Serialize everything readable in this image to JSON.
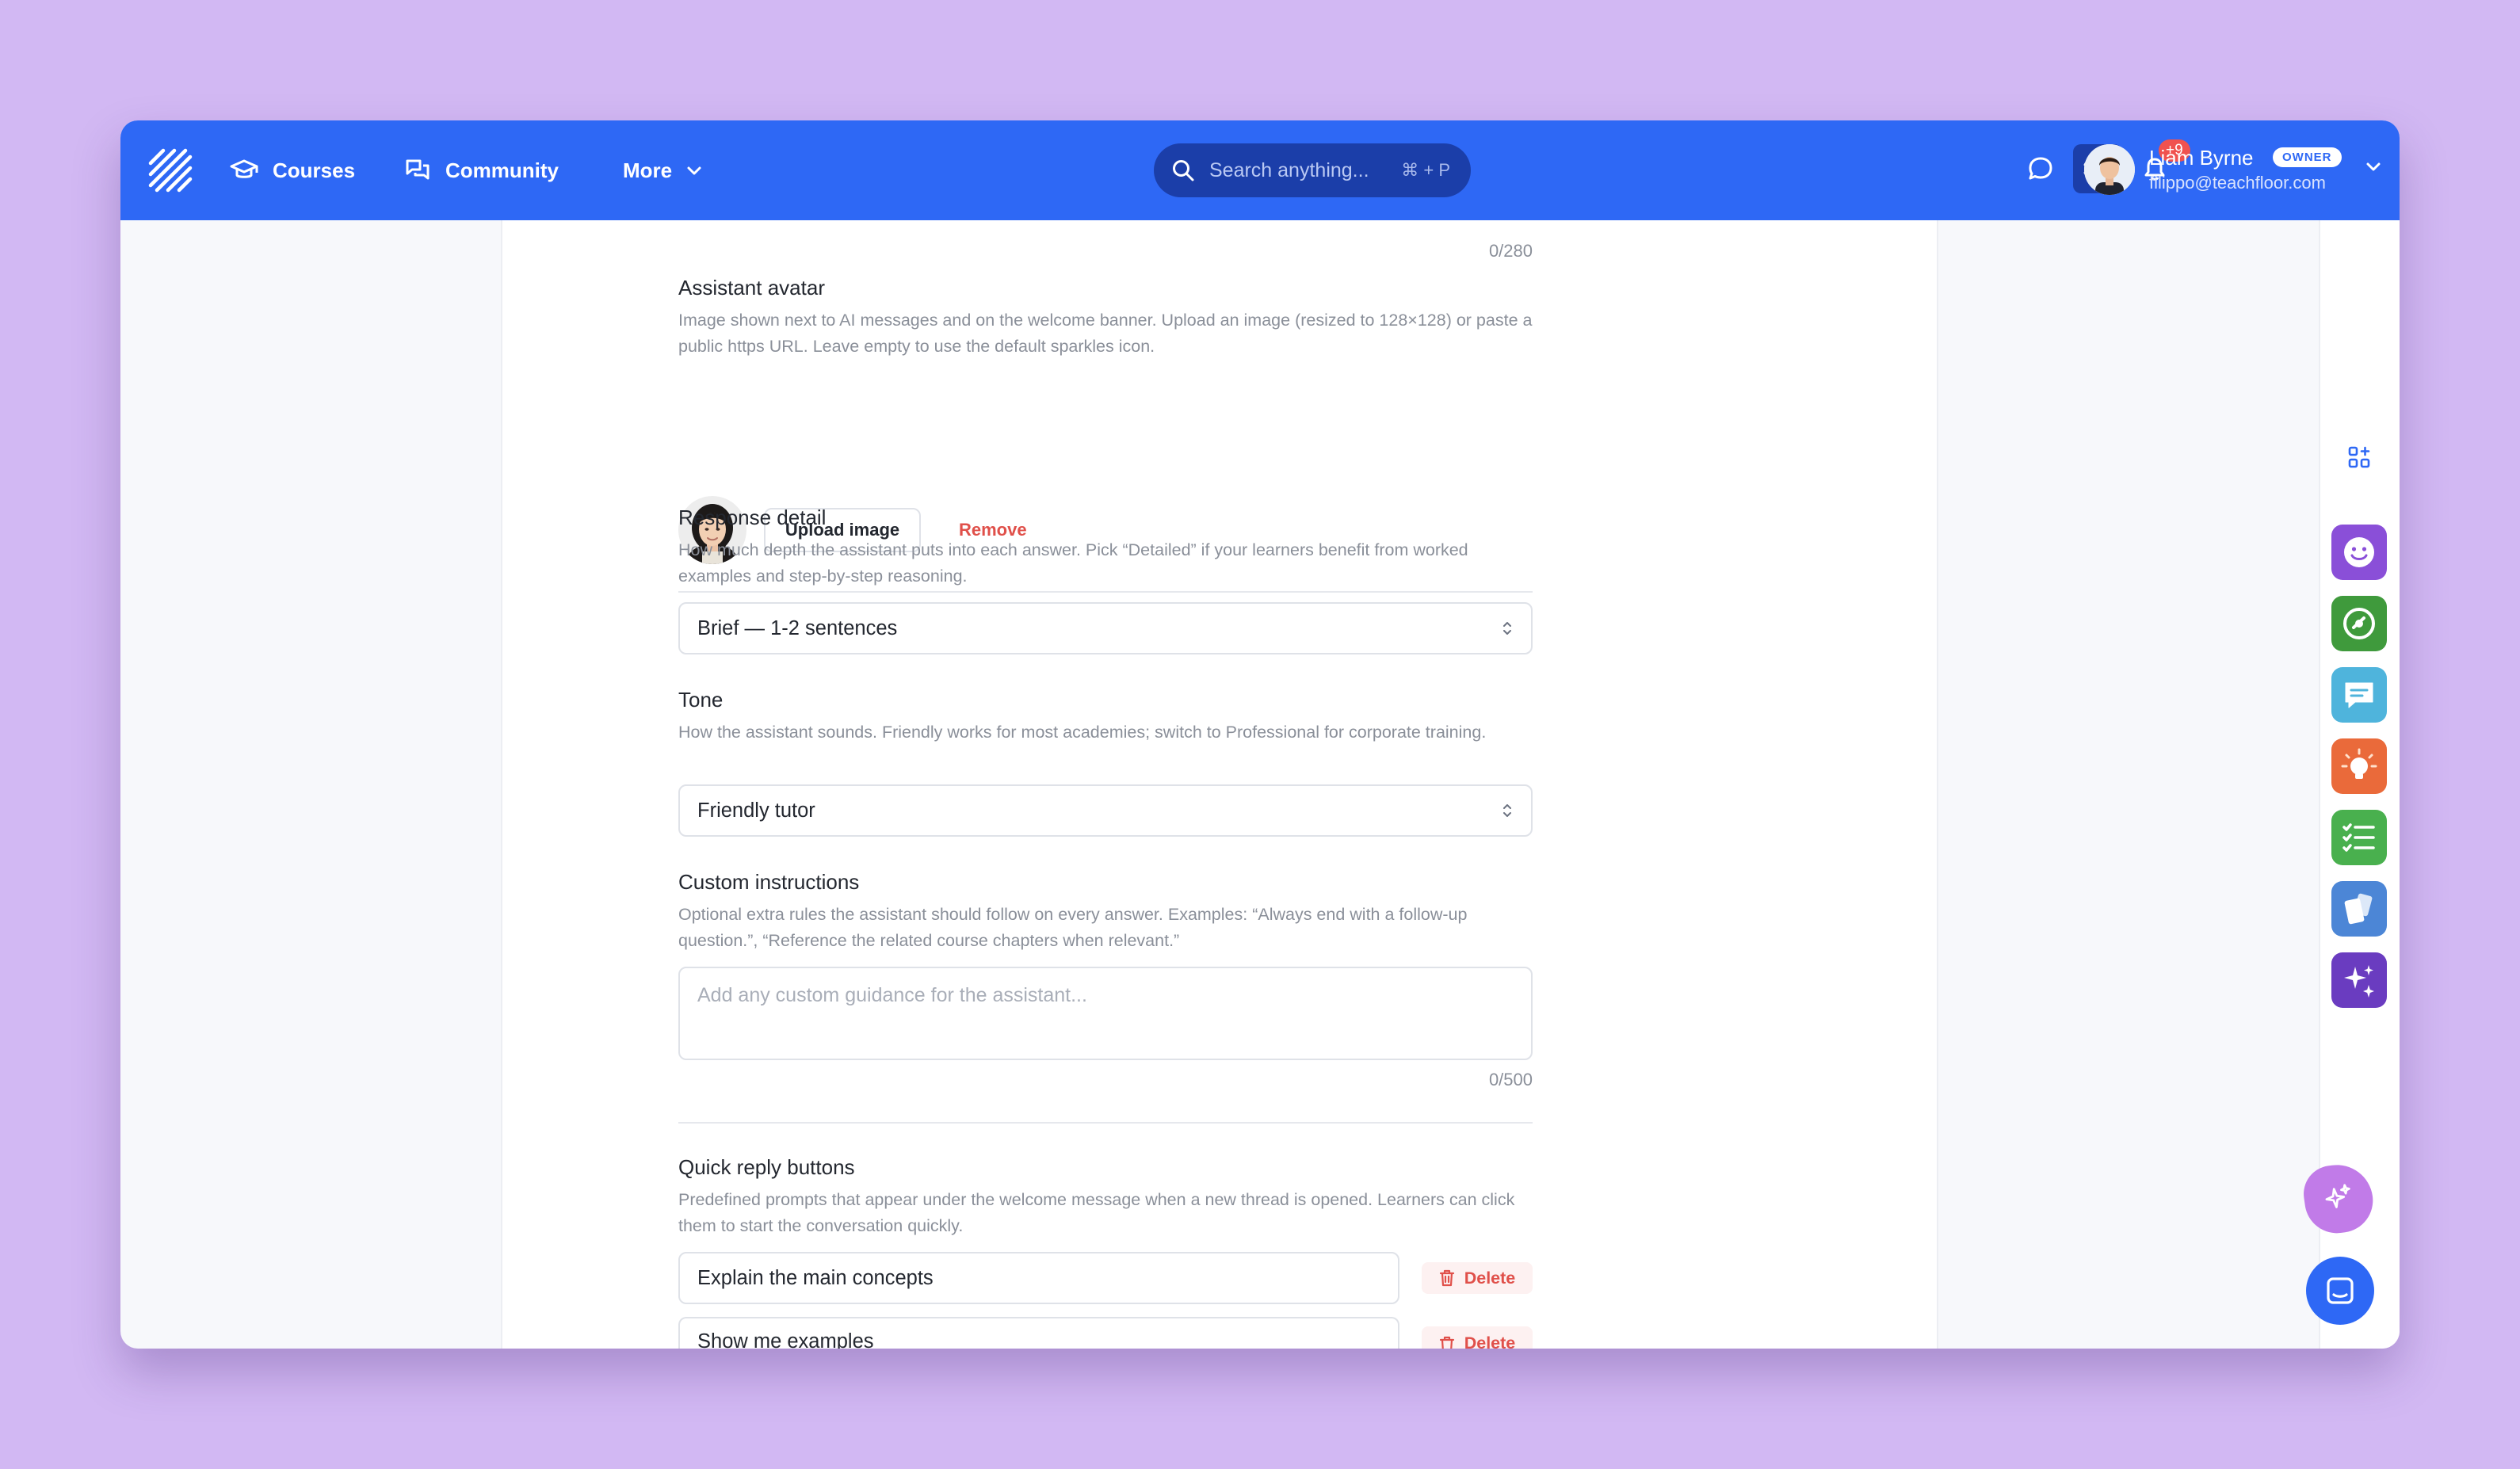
{
  "nav": {
    "courses": "Courses",
    "community": "Community",
    "more": "More"
  },
  "search": {
    "placeholder": "Search anything...",
    "shortcut": "⌘ + P"
  },
  "notifications": {
    "badge": "+9"
  },
  "user": {
    "name": "Liam Byrne",
    "role": "OWNER",
    "email": "filippo@teachfloor.com"
  },
  "form": {
    "top_counter": "0/280",
    "avatar": {
      "label": "Assistant avatar",
      "description": "Image shown next to AI messages and on the welcome banner. Upload an image (resized to 128×128) or paste a public https URL. Leave empty to use the default sparkles icon.",
      "upload_label": "Upload image",
      "remove_label": "Remove"
    },
    "response_detail": {
      "label": "Response detail",
      "description": "How much depth the assistant puts into each answer. Pick “Detailed” if your learners benefit from worked examples and step-by-step reasoning.",
      "value": "Brief — 1-2 sentences"
    },
    "tone": {
      "label": "Tone",
      "description": "How the assistant sounds. Friendly works for most academies; switch to Professional for corporate training.",
      "value": "Friendly tutor"
    },
    "custom_instructions": {
      "label": "Custom instructions",
      "description": "Optional extra rules the assistant should follow on every answer. Examples: “Always end with a follow-up question.”, “Reference the related course chapters when relevant.”",
      "placeholder": "Add any custom guidance for the assistant...",
      "counter": "0/500"
    },
    "quick_replies": {
      "label": "Quick reply buttons",
      "description": "Predefined prompts that appear under the welcome message when a new thread is opened. Learners can click them to start the conversation quickly.",
      "delete_label": "Delete",
      "items": [
        "Explain the main concepts",
        "Show me examples"
      ]
    }
  },
  "rail_apps": [
    {
      "icon": "smiley-icon",
      "color": "#8a4fd8"
    },
    {
      "icon": "gauge-icon",
      "color": "#3f9a3c"
    },
    {
      "icon": "chat-icon",
      "color": "#4fb4dc"
    },
    {
      "icon": "lightbulb-icon",
      "color": "#ea6a3a"
    },
    {
      "icon": "checklist-icon",
      "color": "#49b04e"
    },
    {
      "icon": "cards-icon",
      "color": "#4c86d6"
    },
    {
      "icon": "sparkles-icon",
      "color": "#6a3cc0"
    }
  ]
}
